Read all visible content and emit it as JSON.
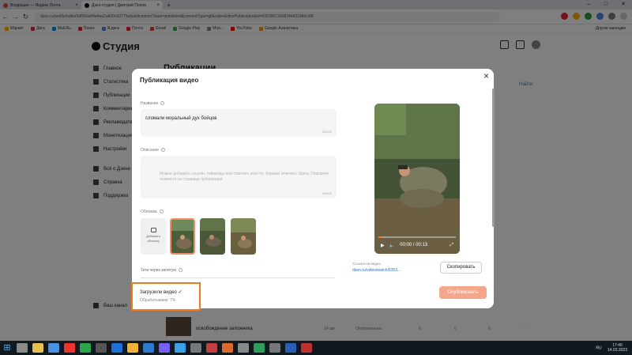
{
  "browser": {
    "tabs": [
      {
        "label": "Входящие — Яндекс Почта",
        "color": "#e54343",
        "close": "×"
      },
      {
        "label": "Дзен-студия | Дмитрий Попов",
        "color": "#111111",
        "close": "×"
      }
    ],
    "new_tab": "+",
    "url": "dzen.ru/profile/editor/id/5f2a6f4a4ea2a600cb3775a/publications?state=published&contentType=gif&videoEditorPublication&id=63538672d3824d4319b0cd3f",
    "bookmarks": [
      "Маркет",
      "Диск",
      "Mail.Ru",
      "Поиск",
      "Я.диск",
      "Почта",
      "Gmail",
      "Google Play",
      "Мое...",
      "YouTube",
      "Google Аналитика"
    ],
    "bookmarks_right": "Другие закладки"
  },
  "studio": {
    "logo": "Студия",
    "sidebar": [
      "Главное",
      "Статистика",
      "Публикации",
      "Комментарии",
      "Рекламодатели",
      "Монетизация",
      "Настройки",
      "Всё о Дзене",
      "Справка",
      "Поддержка"
    ],
    "sidebar_bottom": "Ваш канал",
    "page_title": "Публикации",
    "right_link": "Найти",
    "row": {
      "title": "освобождение заложника",
      "age": "24 авг",
      "status": "Опубликовано",
      "zero1": "0",
      "zero2": "0",
      "zero3": "0",
      "dots": "···"
    }
  },
  "modal": {
    "title": "Публикация видео",
    "close": "×",
    "name_label": "Название",
    "name_value": "сломали моральный дух бойцов",
    "name_count": "26/100",
    "desc_label": "Описание",
    "desc_placeholder": "Можно добавить ссылки, таймкоды или ответить кого-то. Хорошо отмечен. Здесь Описание появится на странице публикации",
    "desc_count": "0/5000",
    "cover_label": "Обложка",
    "add_cover": "Добавить обложку",
    "tags_label": "Теги через запятую",
    "loaded_title": "Загрузили видео",
    "loaded_check": "✓",
    "loaded_status": "Обрабатываем: 7%",
    "video_time": "00:00 / 00:13",
    "video_progress": 0.04,
    "link_label": "Ссылка на видео",
    "link_value": "dzen.ru/video/watch/6353...",
    "copy_button": "Скопировать",
    "publish_button": "Опубликовать"
  },
  "taskbar": {
    "start": "⊞",
    "lang": "RU",
    "time": "17:40",
    "date": "14.03.2023"
  }
}
